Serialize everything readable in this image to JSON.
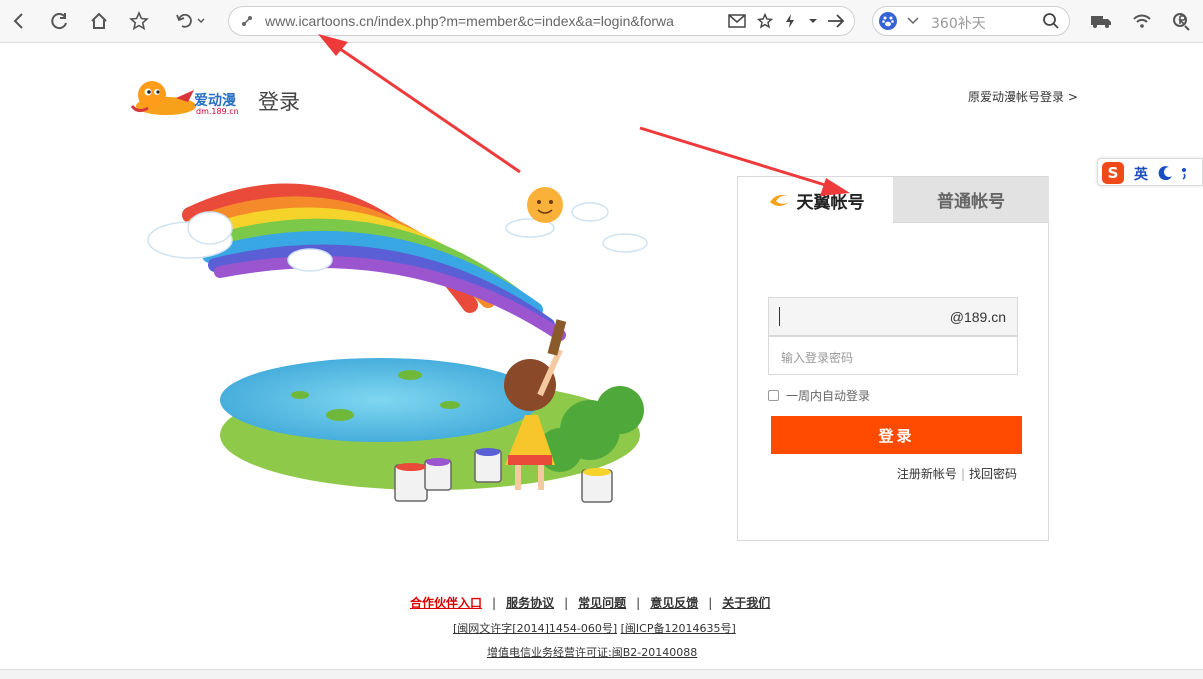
{
  "browser": {
    "url": "www.icartoons.cn/index.php?m=member&c=index&a=login&forwa",
    "search_placeholder": "360补天"
  },
  "header": {
    "logo_text": "爱动漫",
    "logo_domain": "dm.189.cn",
    "title": "登录",
    "original_account_link": "原爱动漫帐号登录 >"
  },
  "login": {
    "tabs": [
      {
        "label": "天翼帐号",
        "active": true
      },
      {
        "label": "普通帐号",
        "active": false
      }
    ],
    "account_suffix": "@189.cn",
    "password_placeholder": "输入登录密码",
    "remember_label": "一周内自动登录",
    "submit_label": "登录",
    "register_link": "注册新帐号",
    "forgot_link": "找回密码"
  },
  "footer": {
    "links": [
      "合作伙伴入口",
      "服务协议",
      "常见问题",
      "意见反馈",
      "关于我们"
    ],
    "license1": "[闽网文许字[2014]1454-060号]",
    "license2": "[闽ICP备12014635号]",
    "license3": "增值电信业务经营许可证:闽B2-20140088"
  },
  "ime": {
    "logo": "S",
    "lang": "英"
  },
  "colors": {
    "accent": "#ff4b00",
    "arrow": "#ee3a3a",
    "footer_highlight": "#dd0000"
  }
}
